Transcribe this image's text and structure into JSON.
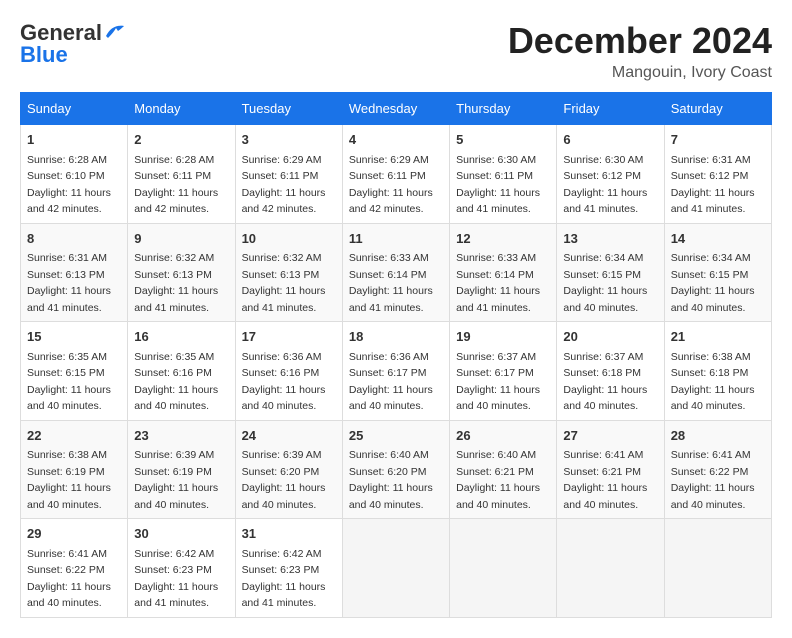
{
  "header": {
    "logo_line1": "General",
    "logo_line2": "Blue",
    "month": "December 2024",
    "location": "Mangouin, Ivory Coast"
  },
  "weekdays": [
    "Sunday",
    "Monday",
    "Tuesday",
    "Wednesday",
    "Thursday",
    "Friday",
    "Saturday"
  ],
  "weeks": [
    [
      {
        "day": "1",
        "sunrise": "6:28 AM",
        "sunset": "6:10 PM",
        "daylight": "11 hours and 42 minutes."
      },
      {
        "day": "2",
        "sunrise": "6:28 AM",
        "sunset": "6:11 PM",
        "daylight": "11 hours and 42 minutes."
      },
      {
        "day": "3",
        "sunrise": "6:29 AM",
        "sunset": "6:11 PM",
        "daylight": "11 hours and 42 minutes."
      },
      {
        "day": "4",
        "sunrise": "6:29 AM",
        "sunset": "6:11 PM",
        "daylight": "11 hours and 42 minutes."
      },
      {
        "day": "5",
        "sunrise": "6:30 AM",
        "sunset": "6:11 PM",
        "daylight": "11 hours and 41 minutes."
      },
      {
        "day": "6",
        "sunrise": "6:30 AM",
        "sunset": "6:12 PM",
        "daylight": "11 hours and 41 minutes."
      },
      {
        "day": "7",
        "sunrise": "6:31 AM",
        "sunset": "6:12 PM",
        "daylight": "11 hours and 41 minutes."
      }
    ],
    [
      {
        "day": "8",
        "sunrise": "6:31 AM",
        "sunset": "6:13 PM",
        "daylight": "11 hours and 41 minutes."
      },
      {
        "day": "9",
        "sunrise": "6:32 AM",
        "sunset": "6:13 PM",
        "daylight": "11 hours and 41 minutes."
      },
      {
        "day": "10",
        "sunrise": "6:32 AM",
        "sunset": "6:13 PM",
        "daylight": "11 hours and 41 minutes."
      },
      {
        "day": "11",
        "sunrise": "6:33 AM",
        "sunset": "6:14 PM",
        "daylight": "11 hours and 41 minutes."
      },
      {
        "day": "12",
        "sunrise": "6:33 AM",
        "sunset": "6:14 PM",
        "daylight": "11 hours and 41 minutes."
      },
      {
        "day": "13",
        "sunrise": "6:34 AM",
        "sunset": "6:15 PM",
        "daylight": "11 hours and 40 minutes."
      },
      {
        "day": "14",
        "sunrise": "6:34 AM",
        "sunset": "6:15 PM",
        "daylight": "11 hours and 40 minutes."
      }
    ],
    [
      {
        "day": "15",
        "sunrise": "6:35 AM",
        "sunset": "6:15 PM",
        "daylight": "11 hours and 40 minutes."
      },
      {
        "day": "16",
        "sunrise": "6:35 AM",
        "sunset": "6:16 PM",
        "daylight": "11 hours and 40 minutes."
      },
      {
        "day": "17",
        "sunrise": "6:36 AM",
        "sunset": "6:16 PM",
        "daylight": "11 hours and 40 minutes."
      },
      {
        "day": "18",
        "sunrise": "6:36 AM",
        "sunset": "6:17 PM",
        "daylight": "11 hours and 40 minutes."
      },
      {
        "day": "19",
        "sunrise": "6:37 AM",
        "sunset": "6:17 PM",
        "daylight": "11 hours and 40 minutes."
      },
      {
        "day": "20",
        "sunrise": "6:37 AM",
        "sunset": "6:18 PM",
        "daylight": "11 hours and 40 minutes."
      },
      {
        "day": "21",
        "sunrise": "6:38 AM",
        "sunset": "6:18 PM",
        "daylight": "11 hours and 40 minutes."
      }
    ],
    [
      {
        "day": "22",
        "sunrise": "6:38 AM",
        "sunset": "6:19 PM",
        "daylight": "11 hours and 40 minutes."
      },
      {
        "day": "23",
        "sunrise": "6:39 AM",
        "sunset": "6:19 PM",
        "daylight": "11 hours and 40 minutes."
      },
      {
        "day": "24",
        "sunrise": "6:39 AM",
        "sunset": "6:20 PM",
        "daylight": "11 hours and 40 minutes."
      },
      {
        "day": "25",
        "sunrise": "6:40 AM",
        "sunset": "6:20 PM",
        "daylight": "11 hours and 40 minutes."
      },
      {
        "day": "26",
        "sunrise": "6:40 AM",
        "sunset": "6:21 PM",
        "daylight": "11 hours and 40 minutes."
      },
      {
        "day": "27",
        "sunrise": "6:41 AM",
        "sunset": "6:21 PM",
        "daylight": "11 hours and 40 minutes."
      },
      {
        "day": "28",
        "sunrise": "6:41 AM",
        "sunset": "6:22 PM",
        "daylight": "11 hours and 40 minutes."
      }
    ],
    [
      {
        "day": "29",
        "sunrise": "6:41 AM",
        "sunset": "6:22 PM",
        "daylight": "11 hours and 40 minutes."
      },
      {
        "day": "30",
        "sunrise": "6:42 AM",
        "sunset": "6:23 PM",
        "daylight": "11 hours and 41 minutes."
      },
      {
        "day": "31",
        "sunrise": "6:42 AM",
        "sunset": "6:23 PM",
        "daylight": "11 hours and 41 minutes."
      },
      null,
      null,
      null,
      null
    ]
  ]
}
